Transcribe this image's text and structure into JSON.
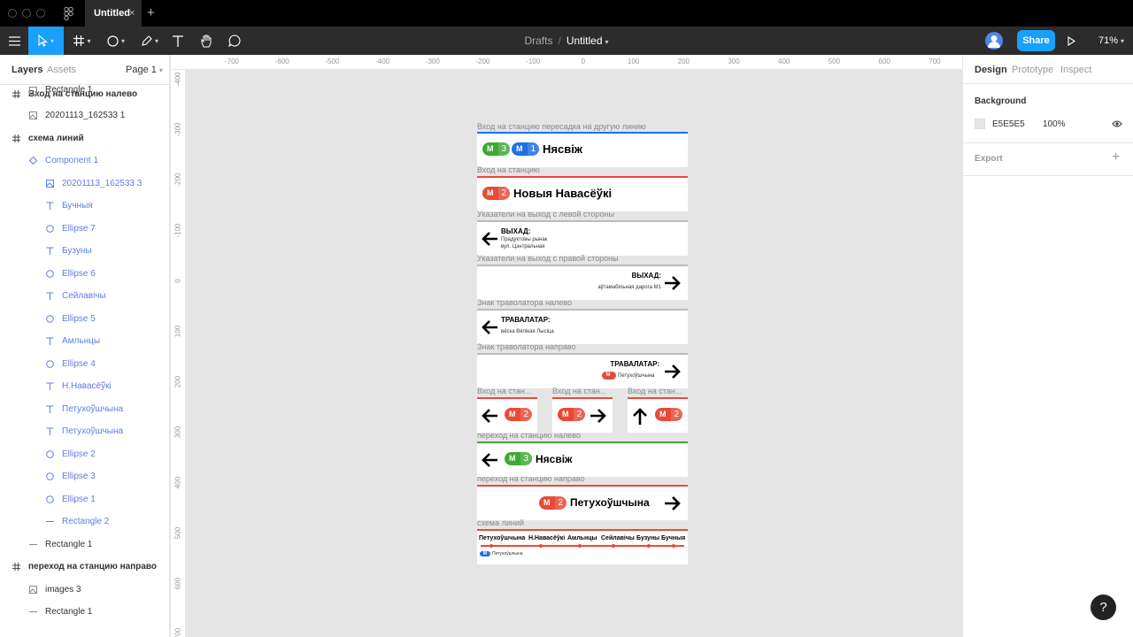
{
  "titlebar": {
    "tab_title": "Untitled",
    "tab_close": "×",
    "tab_add": "+"
  },
  "toolbar": {
    "breadcrumb_project": "Drafts",
    "breadcrumb_sep": "/",
    "breadcrumb_file": "Untitled",
    "share_label": "Share",
    "zoom": "71%"
  },
  "left_panel": {
    "tab_layers": "Layers",
    "tab_assets": "Assets",
    "page": "Page 1",
    "layers": [
      {
        "label": "Вход на станцию налево",
        "kind": "frame"
      },
      {
        "label": "Rectangle 1",
        "kind": "rect",
        "partial": true
      },
      {
        "label": "20201113_162533 1",
        "kind": "image"
      },
      {
        "label": "схема линий",
        "kind": "frame"
      },
      {
        "label": "Component 1",
        "kind": "component"
      },
      {
        "label": "20201113_162533 3",
        "kind": "image-blue"
      },
      {
        "label": "Бучныя",
        "kind": "text"
      },
      {
        "label": "Ellipse 7",
        "kind": "ellipse"
      },
      {
        "label": "Бузуны",
        "kind": "text"
      },
      {
        "label": "Ellipse 6",
        "kind": "ellipse"
      },
      {
        "label": "Сейлавічы",
        "kind": "text"
      },
      {
        "label": "Ellipse 5",
        "kind": "ellipse"
      },
      {
        "label": "Амльнцы",
        "kind": "text"
      },
      {
        "label": "Ellipse 4",
        "kind": "ellipse"
      },
      {
        "label": "Н.Навасёўкі",
        "kind": "text"
      },
      {
        "label": "Петухоўшчына",
        "kind": "text"
      },
      {
        "label": "Петухоўшчына",
        "kind": "text"
      },
      {
        "label": "Ellipse 2",
        "kind": "ellipse"
      },
      {
        "label": "Ellipse 3",
        "kind": "ellipse"
      },
      {
        "label": "Ellipse 1",
        "kind": "ellipse"
      },
      {
        "label": "Rectangle 2",
        "kind": "line-blue"
      },
      {
        "label": "Rectangle 1",
        "kind": "line"
      },
      {
        "label": "переход на станцию направо",
        "kind": "frame"
      },
      {
        "label": "images 3",
        "kind": "image"
      },
      {
        "label": "Rectangle 1",
        "kind": "line"
      }
    ]
  },
  "rulers": {
    "top": [
      "-700",
      "-600",
      "-500",
      "-400",
      "-300",
      "-200",
      "-100",
      "0",
      "100",
      "200",
      "300",
      "400",
      "500",
      "600",
      "700"
    ],
    "left": [
      "-400",
      "-300",
      "-200",
      "-100",
      "0",
      "100",
      "200",
      "300",
      "400",
      "500",
      "600",
      "700"
    ]
  },
  "canvas": {
    "frames": {
      "f1": {
        "label": "Вход на станцию пересадка на другую линию",
        "b1": "3",
        "b2": "1",
        "station": "Нясвіж"
      },
      "f2": {
        "label": "Вход на станцию",
        "b1": "2",
        "station": "Новыя Навасёўкі"
      },
      "f3": {
        "label": "Указатели на выход с левой стороны",
        "title": "ВЫХАД:",
        "line1": "Прадуктовы рынак",
        "line2": "вул. Цэнтральная"
      },
      "f4": {
        "label": "Указатели на выход с правой стороны",
        "title": "ВЫХАД:",
        "line1": "аўтамабільная дарога М1"
      },
      "f5": {
        "label": "Знак траволатора налево",
        "title": "ТРАВАЛАТАР:",
        "line1": "вёска Вялікая Лысіца"
      },
      "f6": {
        "label": "Знак траволатора направо",
        "title": "ТРАВАЛАТАР:",
        "line1": "Петухоўшчына"
      },
      "f7a": {
        "label": "Вход на стан...",
        "b1": "2"
      },
      "f7b": {
        "label": "Вход на стан...",
        "b1": "2"
      },
      "f7c": {
        "label": "Вход на стан...",
        "b1": "2"
      },
      "f8": {
        "label": "переход на станцию налево",
        "b1": "3",
        "station": "Нясвіж"
      },
      "f9": {
        "label": "переход на станцию направо",
        "b1": "2",
        "station": "Петухоўшчына"
      },
      "f10": {
        "label": "схема линий",
        "stations": [
          "Петухоўшчына",
          "Н.Навасёўкі",
          "Амльнцы",
          "Сейлавічы",
          "Бузуны",
          "Бучныя"
        ],
        "legend": "Петухоўшчына"
      }
    }
  },
  "right_panel": {
    "tab_design": "Design",
    "tab_prototype": "Prototype",
    "tab_inspect": "Inspect",
    "background_title": "Background",
    "background_hex": "E5E5E5",
    "background_opacity": "100%",
    "export_title": "Export",
    "export_add": "+"
  },
  "help": "?",
  "colors": {
    "line_red": "#e84a37",
    "line_green": "#3faa32",
    "line_blue": "#1f6fe8",
    "accent": "#18a0fb"
  }
}
